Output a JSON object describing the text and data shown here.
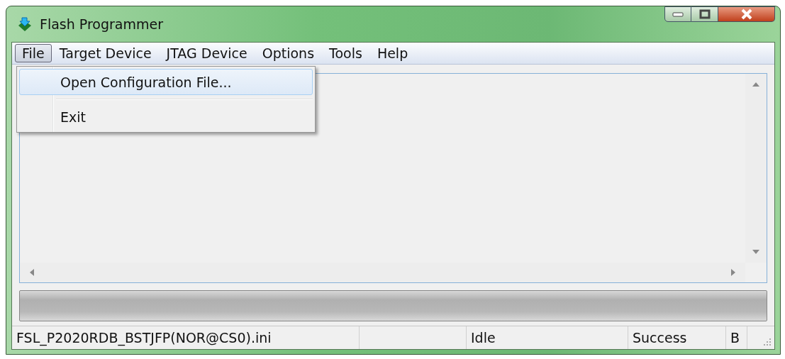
{
  "window": {
    "title": "Flash Programmer"
  },
  "menu": [
    {
      "label": "File",
      "selected": true
    },
    {
      "label": "Target Device",
      "selected": false
    },
    {
      "label": "JTAG Device",
      "selected": false
    },
    {
      "label": "Options",
      "selected": false
    },
    {
      "label": "Tools",
      "selected": false
    },
    {
      "label": "Help",
      "selected": false
    }
  ],
  "dropdown": [
    {
      "kind": "item",
      "label": "Open Configuration File...",
      "selected": true
    },
    {
      "kind": "separator"
    },
    {
      "kind": "item",
      "label": "Exit",
      "selected": false
    }
  ],
  "progress": {
    "level": 0
  },
  "status_bar": [
    "FSL_P2020RDB_BSTJFP(NOR@CS0).ini",
    "Idle",
    "Success",
    "B"
  ]
}
